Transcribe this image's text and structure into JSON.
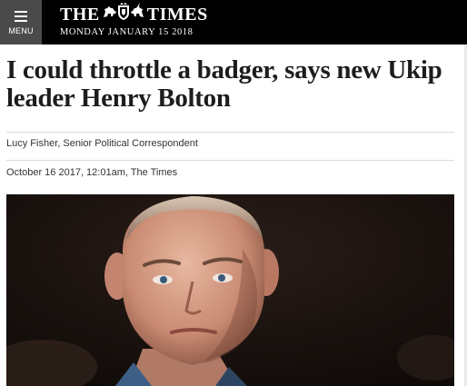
{
  "header": {
    "menu_label": "MENU",
    "logo_left": "THE",
    "logo_right": "TIMES",
    "date": "MONDAY JANUARY 15 2018"
  },
  "article": {
    "headline": "I could throttle a badger, says new Ukip leader Henry Bolton",
    "byline": "Lucy Fisher, Senior Political Correspondent",
    "published": "October 16 2017, 12:01am, The Times"
  },
  "colors": {
    "topbar": "#000000",
    "menu_button": "#4a4a4a",
    "text": "#1d1d1b",
    "rule": "#dcdcdc"
  }
}
